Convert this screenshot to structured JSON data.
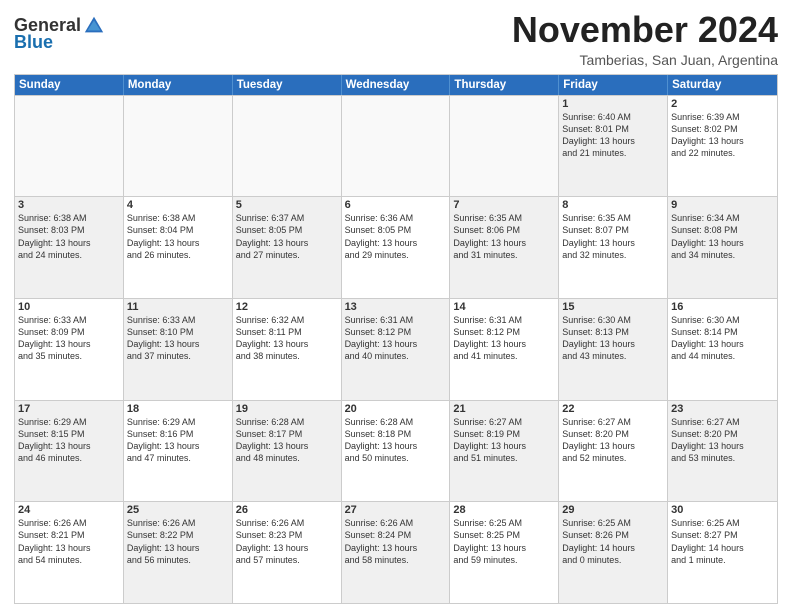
{
  "header": {
    "logo_general": "General",
    "logo_blue": "Blue",
    "month_title": "November 2024",
    "subtitle": "Tamberias, San Juan, Argentina"
  },
  "calendar": {
    "days": [
      "Sunday",
      "Monday",
      "Tuesday",
      "Wednesday",
      "Thursday",
      "Friday",
      "Saturday"
    ],
    "rows": [
      [
        {
          "day": "",
          "text": "",
          "empty": true
        },
        {
          "day": "",
          "text": "",
          "empty": true
        },
        {
          "day": "",
          "text": "",
          "empty": true
        },
        {
          "day": "",
          "text": "",
          "empty": true
        },
        {
          "day": "",
          "text": "",
          "empty": true
        },
        {
          "day": "1",
          "text": "Sunrise: 6:40 AM\nSunset: 8:01 PM\nDaylight: 13 hours\nand 21 minutes.",
          "empty": false,
          "shaded": true
        },
        {
          "day": "2",
          "text": "Sunrise: 6:39 AM\nSunset: 8:02 PM\nDaylight: 13 hours\nand 22 minutes.",
          "empty": false,
          "shaded": false
        }
      ],
      [
        {
          "day": "3",
          "text": "Sunrise: 6:38 AM\nSunset: 8:03 PM\nDaylight: 13 hours\nand 24 minutes.",
          "empty": false,
          "shaded": true
        },
        {
          "day": "4",
          "text": "Sunrise: 6:38 AM\nSunset: 8:04 PM\nDaylight: 13 hours\nand 26 minutes.",
          "empty": false,
          "shaded": false
        },
        {
          "day": "5",
          "text": "Sunrise: 6:37 AM\nSunset: 8:05 PM\nDaylight: 13 hours\nand 27 minutes.",
          "empty": false,
          "shaded": true
        },
        {
          "day": "6",
          "text": "Sunrise: 6:36 AM\nSunset: 8:05 PM\nDaylight: 13 hours\nand 29 minutes.",
          "empty": false,
          "shaded": false
        },
        {
          "day": "7",
          "text": "Sunrise: 6:35 AM\nSunset: 8:06 PM\nDaylight: 13 hours\nand 31 minutes.",
          "empty": false,
          "shaded": true
        },
        {
          "day": "8",
          "text": "Sunrise: 6:35 AM\nSunset: 8:07 PM\nDaylight: 13 hours\nand 32 minutes.",
          "empty": false,
          "shaded": false
        },
        {
          "day": "9",
          "text": "Sunrise: 6:34 AM\nSunset: 8:08 PM\nDaylight: 13 hours\nand 34 minutes.",
          "empty": false,
          "shaded": true
        }
      ],
      [
        {
          "day": "10",
          "text": "Sunrise: 6:33 AM\nSunset: 8:09 PM\nDaylight: 13 hours\nand 35 minutes.",
          "empty": false,
          "shaded": false
        },
        {
          "day": "11",
          "text": "Sunrise: 6:33 AM\nSunset: 8:10 PM\nDaylight: 13 hours\nand 37 minutes.",
          "empty": false,
          "shaded": true
        },
        {
          "day": "12",
          "text": "Sunrise: 6:32 AM\nSunset: 8:11 PM\nDaylight: 13 hours\nand 38 minutes.",
          "empty": false,
          "shaded": false
        },
        {
          "day": "13",
          "text": "Sunrise: 6:31 AM\nSunset: 8:12 PM\nDaylight: 13 hours\nand 40 minutes.",
          "empty": false,
          "shaded": true
        },
        {
          "day": "14",
          "text": "Sunrise: 6:31 AM\nSunset: 8:12 PM\nDaylight: 13 hours\nand 41 minutes.",
          "empty": false,
          "shaded": false
        },
        {
          "day": "15",
          "text": "Sunrise: 6:30 AM\nSunset: 8:13 PM\nDaylight: 13 hours\nand 43 minutes.",
          "empty": false,
          "shaded": true
        },
        {
          "day": "16",
          "text": "Sunrise: 6:30 AM\nSunset: 8:14 PM\nDaylight: 13 hours\nand 44 minutes.",
          "empty": false,
          "shaded": false
        }
      ],
      [
        {
          "day": "17",
          "text": "Sunrise: 6:29 AM\nSunset: 8:15 PM\nDaylight: 13 hours\nand 46 minutes.",
          "empty": false,
          "shaded": true
        },
        {
          "day": "18",
          "text": "Sunrise: 6:29 AM\nSunset: 8:16 PM\nDaylight: 13 hours\nand 47 minutes.",
          "empty": false,
          "shaded": false
        },
        {
          "day": "19",
          "text": "Sunrise: 6:28 AM\nSunset: 8:17 PM\nDaylight: 13 hours\nand 48 minutes.",
          "empty": false,
          "shaded": true
        },
        {
          "day": "20",
          "text": "Sunrise: 6:28 AM\nSunset: 8:18 PM\nDaylight: 13 hours\nand 50 minutes.",
          "empty": false,
          "shaded": false
        },
        {
          "day": "21",
          "text": "Sunrise: 6:27 AM\nSunset: 8:19 PM\nDaylight: 13 hours\nand 51 minutes.",
          "empty": false,
          "shaded": true
        },
        {
          "day": "22",
          "text": "Sunrise: 6:27 AM\nSunset: 8:20 PM\nDaylight: 13 hours\nand 52 minutes.",
          "empty": false,
          "shaded": false
        },
        {
          "day": "23",
          "text": "Sunrise: 6:27 AM\nSunset: 8:20 PM\nDaylight: 13 hours\nand 53 minutes.",
          "empty": false,
          "shaded": true
        }
      ],
      [
        {
          "day": "24",
          "text": "Sunrise: 6:26 AM\nSunset: 8:21 PM\nDaylight: 13 hours\nand 54 minutes.",
          "empty": false,
          "shaded": false
        },
        {
          "day": "25",
          "text": "Sunrise: 6:26 AM\nSunset: 8:22 PM\nDaylight: 13 hours\nand 56 minutes.",
          "empty": false,
          "shaded": true
        },
        {
          "day": "26",
          "text": "Sunrise: 6:26 AM\nSunset: 8:23 PM\nDaylight: 13 hours\nand 57 minutes.",
          "empty": false,
          "shaded": false
        },
        {
          "day": "27",
          "text": "Sunrise: 6:26 AM\nSunset: 8:24 PM\nDaylight: 13 hours\nand 58 minutes.",
          "empty": false,
          "shaded": true
        },
        {
          "day": "28",
          "text": "Sunrise: 6:25 AM\nSunset: 8:25 PM\nDaylight: 13 hours\nand 59 minutes.",
          "empty": false,
          "shaded": false
        },
        {
          "day": "29",
          "text": "Sunrise: 6:25 AM\nSunset: 8:26 PM\nDaylight: 14 hours\nand 0 minutes.",
          "empty": false,
          "shaded": true
        },
        {
          "day": "30",
          "text": "Sunrise: 6:25 AM\nSunset: 8:27 PM\nDaylight: 14 hours\nand 1 minute.",
          "empty": false,
          "shaded": false
        }
      ]
    ]
  }
}
